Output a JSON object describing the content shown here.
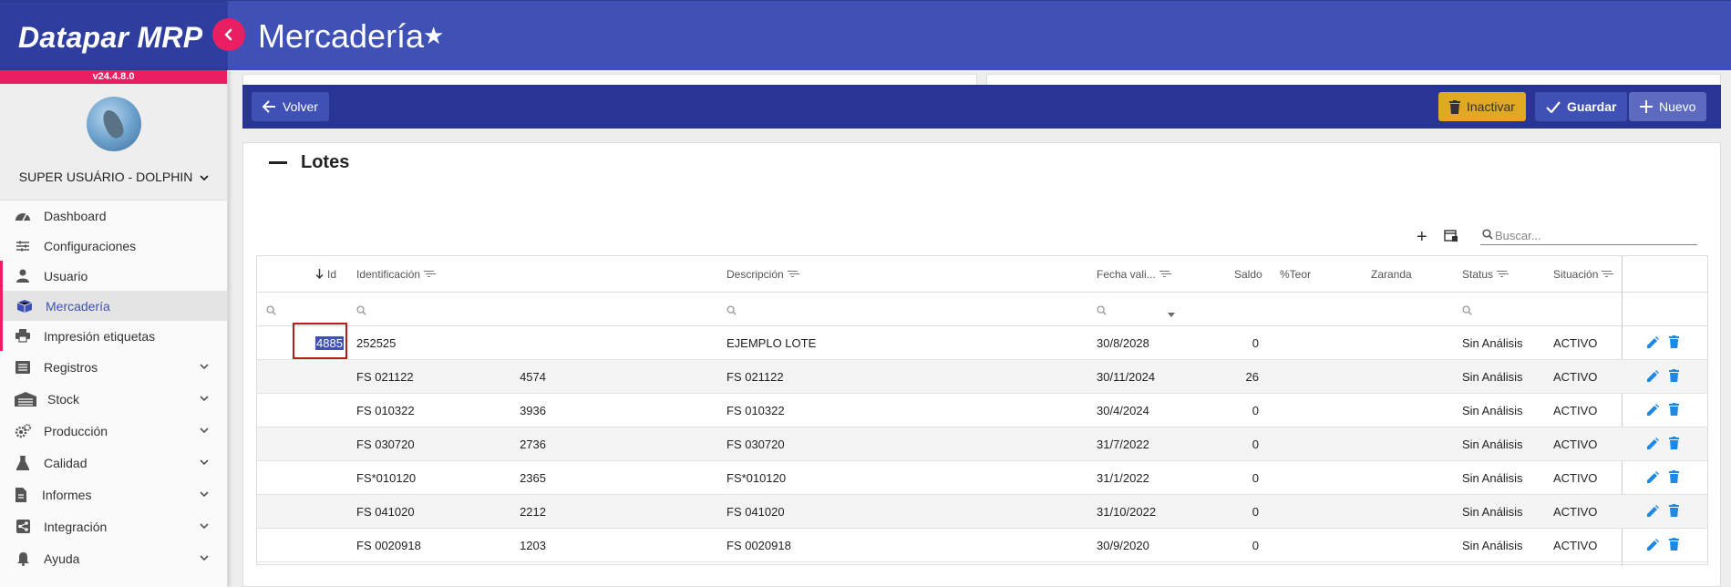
{
  "app": {
    "brand": "Datapar MRP",
    "version": "v24.4.8.0"
  },
  "header": {
    "page_title": "Mercadería"
  },
  "user": {
    "name": "SUPER USUÁRIO - DOLPHIN"
  },
  "sidebar": {
    "items": [
      {
        "label": "Dashboard",
        "icon": "dashboard-icon"
      },
      {
        "label": "Configuraciones",
        "icon": "sliders-icon"
      },
      {
        "label": "Usuario",
        "icon": "user-icon"
      },
      {
        "label": "Mercadería",
        "icon": "box-icon",
        "active": true
      },
      {
        "label": "Impresión etiquetas",
        "icon": "printer-icon"
      },
      {
        "label": "Registros",
        "icon": "list-icon"
      },
      {
        "label": "Stock",
        "icon": "warehouse-icon"
      },
      {
        "label": "Producción",
        "icon": "gears-icon"
      },
      {
        "label": "Calidad",
        "icon": "flask-icon"
      },
      {
        "label": "Informes",
        "icon": "document-icon"
      },
      {
        "label": "Integración",
        "icon": "share-icon"
      },
      {
        "label": "Ayuda",
        "icon": "bell-icon"
      }
    ]
  },
  "toolbar": {
    "back_label": "Volver",
    "inactivate_label": "Inactivar",
    "save_label": "Guardar",
    "new_label": "Nuevo"
  },
  "lotes": {
    "title": "Lotes",
    "search_placeholder": "Buscar...",
    "columns": {
      "id": "Id",
      "identificacion": "Identificación",
      "descripcion": "Descripción",
      "fecha": "Fecha vali...",
      "saldo": "Saldo",
      "teor": "%Teor",
      "zaranda": "Zaranda",
      "status": "Status",
      "situacion": "Situación"
    },
    "rows": [
      {
        "id": "4885",
        "identificacion": "252525",
        "descripcion": "EJEMPLO LOTE",
        "fecha": "30/8/2028",
        "saldo": "0",
        "teor": "",
        "zaranda": "",
        "status": "Sin Análisis",
        "situacion": "ACTIVO"
      },
      {
        "id": "4574",
        "identificacion": "FS 021122",
        "descripcion": "FS 021122",
        "fecha": "30/11/2024",
        "saldo": "26",
        "teor": "",
        "zaranda": "",
        "status": "Sin Análisis",
        "situacion": "ACTIVO"
      },
      {
        "id": "3936",
        "identificacion": "FS 010322",
        "descripcion": "FS 010322",
        "fecha": "30/4/2024",
        "saldo": "0",
        "teor": "",
        "zaranda": "",
        "status": "Sin Análisis",
        "situacion": "ACTIVO"
      },
      {
        "id": "2736",
        "identificacion": "FS 030720",
        "descripcion": "FS 030720",
        "fecha": "31/7/2022",
        "saldo": "0",
        "teor": "",
        "zaranda": "",
        "status": "Sin Análisis",
        "situacion": "ACTIVO"
      },
      {
        "id": "2365",
        "identificacion": "FS*010120",
        "descripcion": "FS*010120",
        "fecha": "31/1/2022",
        "saldo": "0",
        "teor": "",
        "zaranda": "",
        "status": "Sin Análisis",
        "situacion": "ACTIVO"
      },
      {
        "id": "2212",
        "identificacion": "FS 041020",
        "descripcion": "FS 041020",
        "fecha": "31/10/2022",
        "saldo": "0",
        "teor": "",
        "zaranda": "",
        "status": "Sin Análisis",
        "situacion": "ACTIVO"
      },
      {
        "id": "1203",
        "identificacion": "FS 0020918",
        "descripcion": "FS 0020918",
        "fecha": "30/9/2020",
        "saldo": "0",
        "teor": "",
        "zaranda": "",
        "status": "Sin Análisis",
        "situacion": "ACTIVO"
      }
    ]
  },
  "colors": {
    "primary": "#3f51b5",
    "dark": "#283593",
    "accent": "#e91e63",
    "warning": "#e0a921",
    "action": "#1e88e5"
  }
}
